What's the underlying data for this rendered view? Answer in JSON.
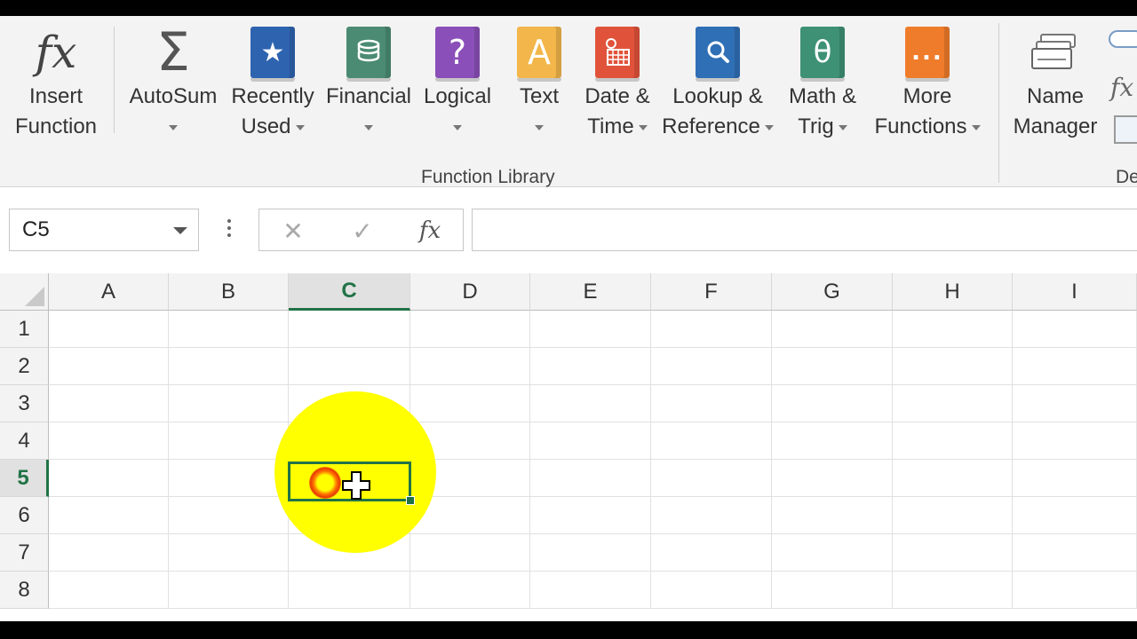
{
  "ribbon": {
    "buttons": [
      {
        "label1": "Insert",
        "label2": "Function",
        "icon": "fx-icon"
      },
      {
        "label1": "AutoSum",
        "label2": "",
        "icon": "sigma-icon"
      },
      {
        "label1": "Recently",
        "label2": "Used",
        "icon": "star-book-icon"
      },
      {
        "label1": "Financial",
        "label2": "",
        "icon": "coins-book-icon"
      },
      {
        "label1": "Logical",
        "label2": "",
        "icon": "question-book-icon"
      },
      {
        "label1": "Text",
        "label2": "",
        "icon": "text-book-icon"
      },
      {
        "label1": "Date &",
        "label2": "Time",
        "icon": "calendar-book-icon"
      },
      {
        "label1": "Lookup &",
        "label2": "Reference",
        "icon": "magnifier-book-icon"
      },
      {
        "label1": "Math &",
        "label2": "Trig",
        "icon": "theta-book-icon"
      },
      {
        "label1": "More",
        "label2": "Functions",
        "icon": "ellipsis-book-icon"
      },
      {
        "label1": "Name",
        "label2": "Manager",
        "icon": "name-manager-icon"
      }
    ],
    "group_label": "Function Library",
    "next_group_label": "De",
    "icon_glyphs": {
      "fx": "fx",
      "sigma": "Σ",
      "star": "★",
      "question": "?",
      "text": "A",
      "theta": "θ",
      "more": "..."
    },
    "colors": {
      "star_book": "#2e63b0",
      "coins_book": "#4b8b73",
      "question_book": "#8a4fb8",
      "text_book": "#f2b64a",
      "calendar_book": "#e0533a",
      "magnifier_book": "#2f6fb6",
      "theta_book": "#3e9175",
      "more_book": "#ef7c2b"
    }
  },
  "formula_bar": {
    "name_box": "C5",
    "cancel_glyph": "✕",
    "enter_glyph": "✓",
    "fx_glyph": "fx",
    "formula": ""
  },
  "sheet": {
    "columns": [
      "A",
      "B",
      "C",
      "D",
      "E",
      "F",
      "G",
      "H",
      "I"
    ],
    "rows": [
      "1",
      "2",
      "3",
      "4",
      "5",
      "6",
      "7",
      "8"
    ],
    "active_column": "C",
    "active_row": "5",
    "accent": "#217346"
  }
}
